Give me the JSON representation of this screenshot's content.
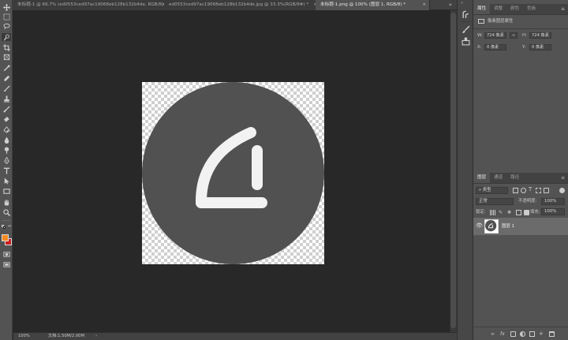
{
  "tabs": [
    {
      "label": "未标题-1 @ 66.7% (ed0553ced97ac19068eb128b132b4de, RGB/8) *",
      "close": "×"
    },
    {
      "label": "ed0553ced97ac19068eb128b132b4de.jpg @ 33.3%(RGB/8#) *",
      "close": "×"
    },
    {
      "label": "未标题-1.png @ 100% (图层 1, RGB/8) *",
      "close": "×"
    }
  ],
  "status": {
    "zoom": "100%",
    "doc_info": "文档:1.50M/2.00M"
  },
  "properties": {
    "tabs": [
      "属性",
      "调整",
      "颜色",
      "色板"
    ],
    "menu_glyph": "≡",
    "section_title": "像素图层属性",
    "w_label": "W:",
    "w_value": "724 像素",
    "h_label": "H:",
    "h_value": "724 像素",
    "x_label": "X:",
    "x_value": "0 像素",
    "y_label": "Y:",
    "y_value": "0 像素"
  },
  "layers_panel": {
    "tabs": [
      "图层",
      "通道",
      "路径"
    ],
    "menu_glyph": "≡",
    "filter_kind": "类型",
    "blend_mode": "正常",
    "opacity_label": "不透明度:",
    "opacity_value": "100%",
    "lock_label": "锁定:",
    "fill_label": "填充:",
    "fill_value": "100%",
    "layers": [
      {
        "name": "图层 1",
        "visible": true,
        "selected": true
      }
    ]
  },
  "colors": {
    "foreground": "#f58a1f",
    "background": "#c8201e",
    "artwork_circle": "#515151",
    "artwork_glyph": "#f2f2f2"
  },
  "icons": {
    "tools": [
      "move-icon",
      "marquee-icon",
      "lasso-icon",
      "quick-select-icon",
      "crop-icon",
      "frame-icon",
      "eyedropper-icon",
      "healing-brush-icon",
      "brush-icon",
      "clone-stamp-icon",
      "history-brush-icon",
      "eraser-icon",
      "gradient-icon",
      "blur-icon",
      "dodge-icon",
      "pen-icon",
      "type-icon",
      "path-select-icon",
      "rectangle-icon",
      "hand-icon",
      "zoom-icon"
    ]
  }
}
